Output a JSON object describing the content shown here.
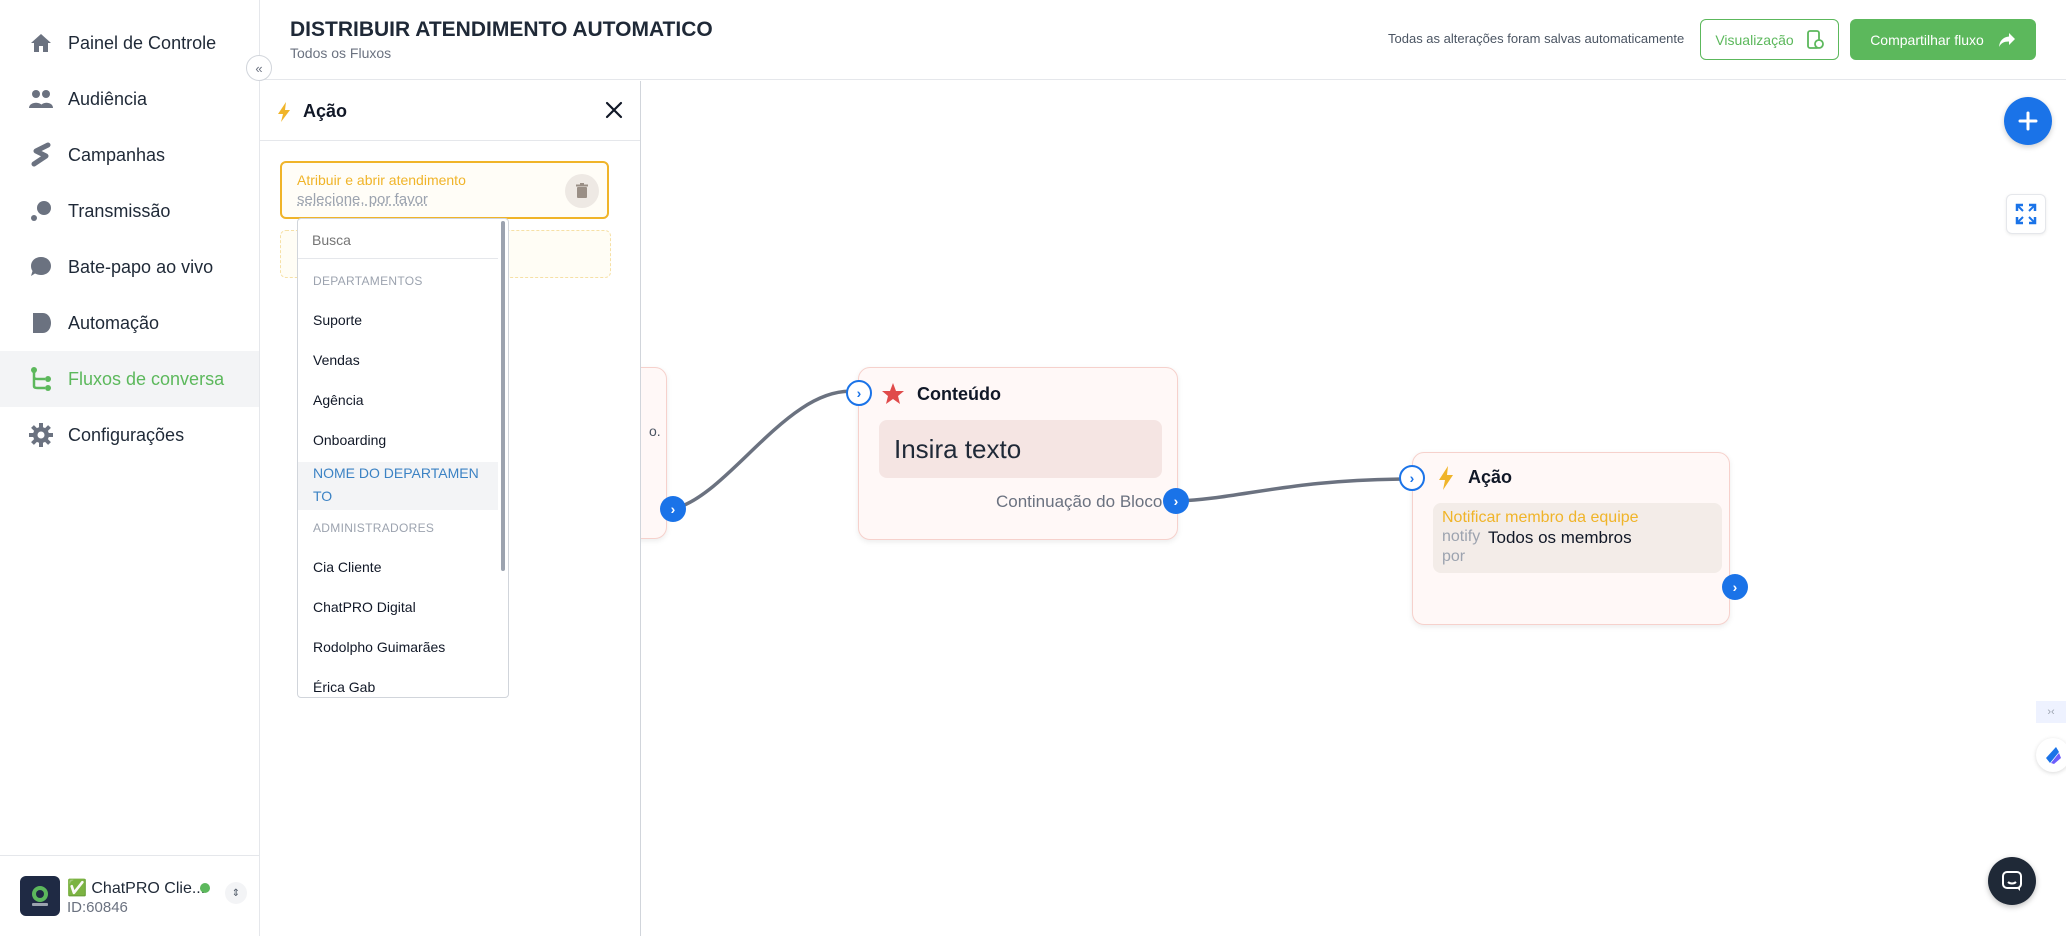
{
  "sidebar": {
    "items": [
      {
        "label": "Painel de Controle"
      },
      {
        "label": "Audiência"
      },
      {
        "label": "Campanhas"
      },
      {
        "label": "Transmissão"
      },
      {
        "label": "Bate-papo ao vivo"
      },
      {
        "label": "Automação"
      },
      {
        "label": "Fluxos de conversa",
        "active": true
      },
      {
        "label": "Configurações"
      }
    ],
    "footer": {
      "account_name": "✅ ChatPRO Clie...",
      "account_id": "ID:60846"
    }
  },
  "header": {
    "title": "DISTRIBUIR ATENDIMENTO AUTOMATICO",
    "breadcrumb": "Todos os Fluxos",
    "save_status": "Todas as alterações foram salvas automaticamente",
    "preview_label": "Visualização",
    "share_label": "Compartilhar fluxo"
  },
  "panel": {
    "title": "Ação",
    "select_label": "Atribuir e abrir atendimento",
    "select_placeholder": "selecione, por favor",
    "dropdown": {
      "search_placeholder": "Busca",
      "group_departments": "DEPARTAMENTOS",
      "departments": [
        "Suporte",
        "Vendas",
        "Agência",
        "Onboarding"
      ],
      "highlighted_line1": "NOME DO DEPARTAMEN",
      "highlighted_line2": "TO",
      "group_admins": "ADMINISTRADORES",
      "admins": [
        "Cia Cliente",
        "ChatPRO Digital",
        "Rodolpho Guimarães",
        "Érica Gab"
      ]
    }
  },
  "canvas": {
    "partial_node_text": "o.",
    "content_node": {
      "title": "Conteúdo",
      "text": "Insira texto",
      "continuation": "Continuação do Bloco"
    },
    "action_node": {
      "title": "Ação",
      "action_label": "Notificar membro da equipe",
      "notify_word": "notify",
      "notify_value": "Todos os membros",
      "by_word": "por"
    }
  },
  "colors": {
    "brand_green": "#5cb85c",
    "accent_blue": "#1a73e8",
    "warning_orange": "#f0b429",
    "star_red": "#e04b4b"
  }
}
